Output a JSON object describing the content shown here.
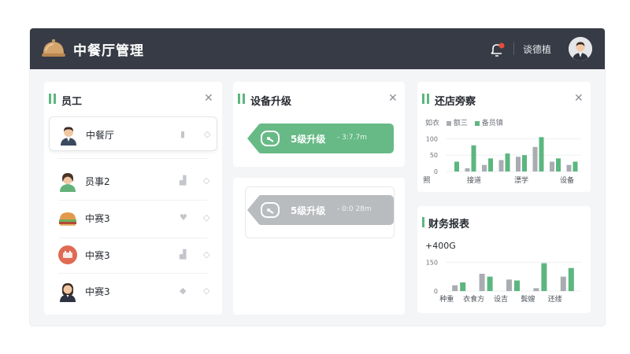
{
  "app": {
    "title": "中餐厅管理"
  },
  "header": {
    "user_name": "谈德植",
    "notification_icon": "bell-icon"
  },
  "employees": {
    "title": "员工",
    "items": [
      {
        "name": "中餐厅",
        "avatar": "man-avatar",
        "active": true,
        "action1_icon": "trash-icon",
        "action2_icon": "tag-icon"
      },
      {
        "name": "员事2",
        "avatar": "chef-woman-avatar",
        "active": false,
        "action1_icon": "chart-icon",
        "action2_icon": "tag-icon"
      },
      {
        "name": "中赛3",
        "avatar": "food-dish-avatar",
        "active": false,
        "action1_icon": "heart-icon",
        "action2_icon": "tag-icon"
      },
      {
        "name": "中赛3",
        "avatar": "orange-badge-avatar",
        "active": false,
        "action1_icon": "chart-icon",
        "action2_icon": "tag-icon"
      },
      {
        "name": "中赛3",
        "avatar": "woman-avatar",
        "active": false,
        "action1_icon": "diamond-icon",
        "action2_icon": "tag-icon"
      }
    ]
  },
  "device": {
    "title": "设备升级",
    "upgrade_green": {
      "label": "5级升级",
      "sub": "- 3:7.7m",
      "color": "#67ba86"
    },
    "upgrade_gray": {
      "label": "5级升级",
      "sub": "- 0:0 28m",
      "color": "#b9bcbf"
    }
  },
  "shop_chart": {
    "title": "还店旁察",
    "legend": [
      {
        "label": "额三",
        "color": "#a9adb2"
      },
      {
        "label": "备员镇",
        "color": "#5cb67f"
      }
    ],
    "y_label": "如衣"
  },
  "finance": {
    "title": "财务报表",
    "headline": "+400G"
  },
  "chart_data": [
    {
      "type": "bar",
      "title": "还店旁察",
      "ylabel": "如衣",
      "categories": [
        "照",
        "接道",
        "漂学",
        "设备"
      ],
      "series": [
        {
          "name": "额三",
          "values": [
            null,
            10,
            20,
            35,
            45,
            75,
            30,
            20
          ]
        },
        {
          "name": "备员镇",
          "values": [
            30,
            80,
            40,
            55,
            50,
            105,
            40,
            30
          ]
        }
      ],
      "group_x": [
        0,
        1,
        2,
        2,
        2,
        2,
        3,
        3
      ],
      "yticks": [
        0,
        50,
        100
      ],
      "ylim": [
        0,
        125
      ]
    },
    {
      "type": "bar",
      "title": "财务报表",
      "categories": [
        "种重",
        "衣食方",
        "设吉",
        "鬓嫂",
        "还缕"
      ],
      "series": [
        {
          "name": "gray",
          "values": [
            30,
            90,
            60,
            15,
            75
          ]
        },
        {
          "name": "green",
          "values": [
            45,
            75,
            55,
            145,
            120
          ]
        }
      ],
      "yticks": [
        0,
        150
      ],
      "ylim": [
        0,
        180
      ]
    }
  ]
}
